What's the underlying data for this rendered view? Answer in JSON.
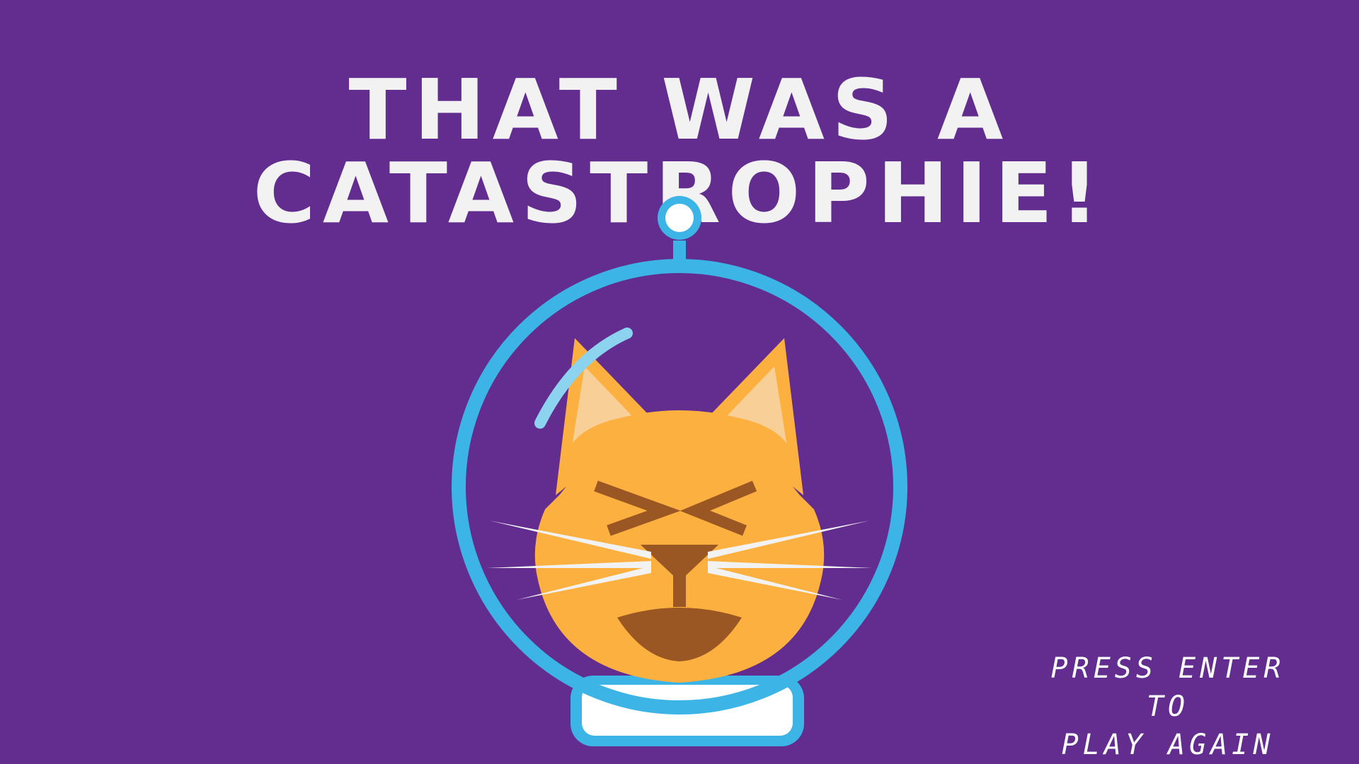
{
  "screen": {
    "name": "game-over",
    "title": "THAT WAS A CATASTROPHIE!",
    "prompt": {
      "line1": "PRESS ENTER TO",
      "line2": "PLAY AGAIN"
    }
  },
  "colors": {
    "background": "#632d8f",
    "title_text": "#f2f2f2",
    "helmet": "#3cb4e6",
    "helmet_glint": "#8bd3ef",
    "cat_fur": "#fbb040",
    "cat_ear_inner": "#f9cf98",
    "cat_features": "#9b5723",
    "whiskers": "#f2f2f2",
    "collar": "#ffffff"
  },
  "character": {
    "type": "astronaut-cat",
    "expression": "eyes-squeezed-laughing"
  }
}
